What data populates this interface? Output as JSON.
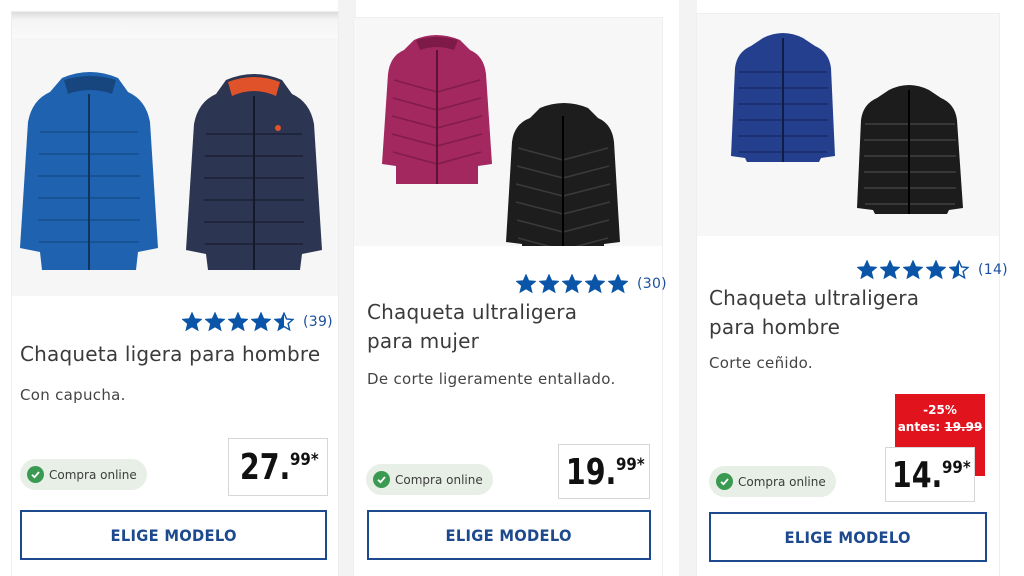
{
  "colors": {
    "brand_blue": "#1d4a8f",
    "star_blue": "#0b55a8",
    "online_green": "#3a9a52",
    "discount_red": "#e1141e"
  },
  "products": [
    {
      "rating_value": 4.5,
      "rating_count": "(39)",
      "title": "Chaqueta ligera para hombre",
      "description": "Con capucha.",
      "online_label": "Compra online",
      "price_int": "27.",
      "price_dec": "99*",
      "button_label": "ELIGE MODELO",
      "jacket_colors": [
        "#1f62b0",
        "#2c3552"
      ],
      "image_icons": [
        "jacket-blue-hooded-icon",
        "jacket-navy-hooded-icon"
      ]
    },
    {
      "rating_value": 5,
      "rating_count": "(30)",
      "title": "Chaqueta ultraligera para mujer",
      "description": "De corte ligeramente entallado.",
      "online_label": "Compra online",
      "price_int": "19.",
      "price_dec": "99*",
      "button_label": "ELIGE MODELO",
      "jacket_colors": [
        "#a3285f",
        "#1d1d1d"
      ],
      "image_icons": [
        "jacket-magenta-women-icon",
        "jacket-black-women-icon"
      ]
    },
    {
      "rating_value": 4.5,
      "rating_count": "(14)",
      "title": "Chaqueta ultraligera para hombre",
      "description": "Corte ceñido.",
      "discount_percent": "-25%",
      "discount_old_label": "antes:",
      "discount_old_price": "19.99",
      "online_label": "Compra online",
      "price_int": "14.",
      "price_dec": "99*",
      "button_label": "ELIGE MODELO",
      "jacket_colors": [
        "#253f8f",
        "#1c1c1c"
      ],
      "image_icons": [
        "jacket-navy-men-icon",
        "jacket-black-men-icon"
      ]
    }
  ]
}
